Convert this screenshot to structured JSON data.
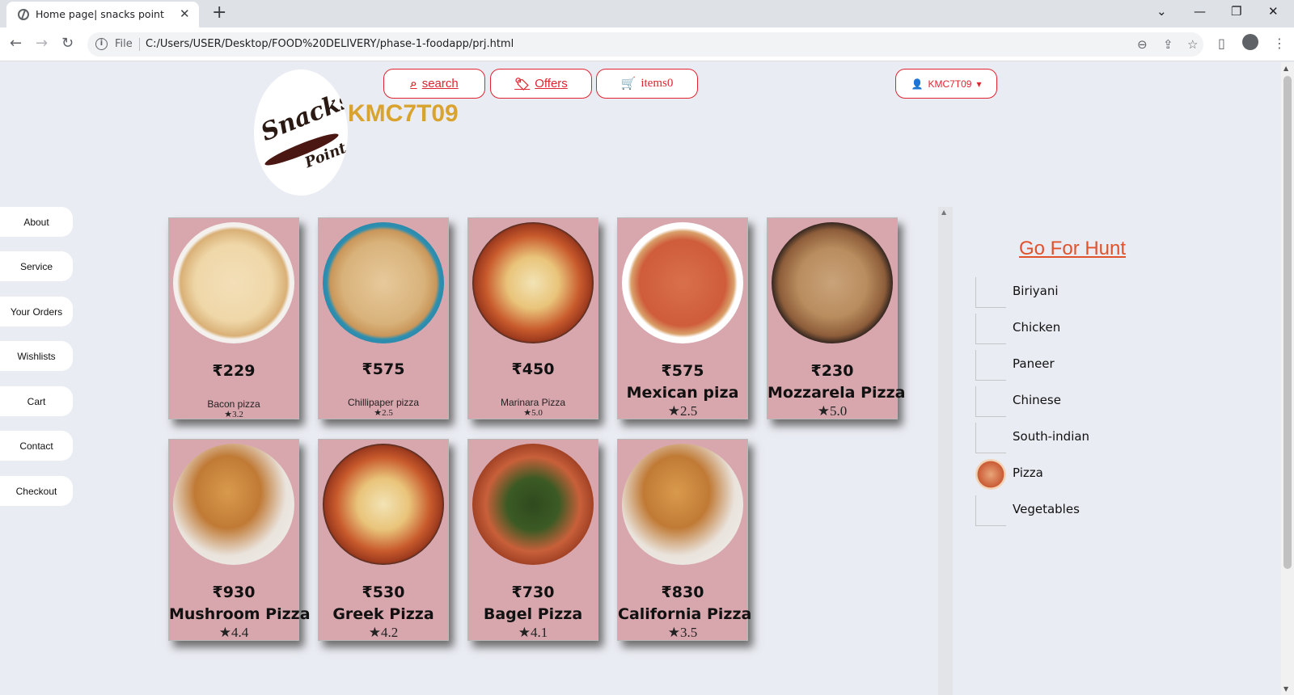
{
  "browser": {
    "tab_title": "Home page| snacks point",
    "address_scheme": "File",
    "url": "C:/Users/USER/Desktop/FOOD%20DELIVERY/phase-1-foodapp/prj.html"
  },
  "header": {
    "logo_text_main": "Snacks",
    "logo_text_sub": "Point",
    "brand_name": "KMC7T09",
    "search_label": "search",
    "offers_label": "Offers",
    "cart_label": "items0",
    "user_label": "KMC7T09"
  },
  "sidebar": {
    "items": [
      {
        "label": "About"
      },
      {
        "label": "Service"
      },
      {
        "label": "Your Orders"
      },
      {
        "label": "Wishlists"
      },
      {
        "label": "Cart"
      },
      {
        "label": "Contact"
      },
      {
        "label": "Checkout"
      }
    ]
  },
  "products": [
    {
      "price": "₹229",
      "name": "Bacon pizza",
      "rating": "3.2",
      "style": "small"
    },
    {
      "price": "₹575",
      "name": "Chillipaper pizza",
      "rating": "2.5",
      "style": "small"
    },
    {
      "price": "₹450",
      "name": "Marinara Pizza",
      "rating": "5.0",
      "style": "small"
    },
    {
      "price": "₹575",
      "name": "Mexican piza",
      "rating": "2.5",
      "style": "big"
    },
    {
      "price": "₹230",
      "name": "Mozzarela Pizza",
      "rating": "5.0",
      "style": "big"
    },
    {
      "price": "₹930",
      "name": "Mushroom Pizza",
      "rating": "4.4",
      "style": "big"
    },
    {
      "price": "₹530",
      "name": "Greek Pizza",
      "rating": "4.2",
      "style": "big"
    },
    {
      "price": "₹730",
      "name": "Bagel Pizza",
      "rating": "4.1",
      "style": "big"
    },
    {
      "price": "₹830",
      "name": "California Pizza",
      "rating": "3.5",
      "style": "big"
    }
  ],
  "categories": {
    "title": "Go For Hunt",
    "items": [
      {
        "label": "Biriyani"
      },
      {
        "label": "Chicken"
      },
      {
        "label": "Paneer"
      },
      {
        "label": "Chinese"
      },
      {
        "label": "South-indian"
      },
      {
        "label": "Pizza"
      },
      {
        "label": "Vegetables"
      }
    ]
  },
  "colors": {
    "accent": "#e0242f",
    "brand": "#d9a330",
    "card_bg": "#d8a7ae",
    "hunt_title": "#e0522c"
  }
}
